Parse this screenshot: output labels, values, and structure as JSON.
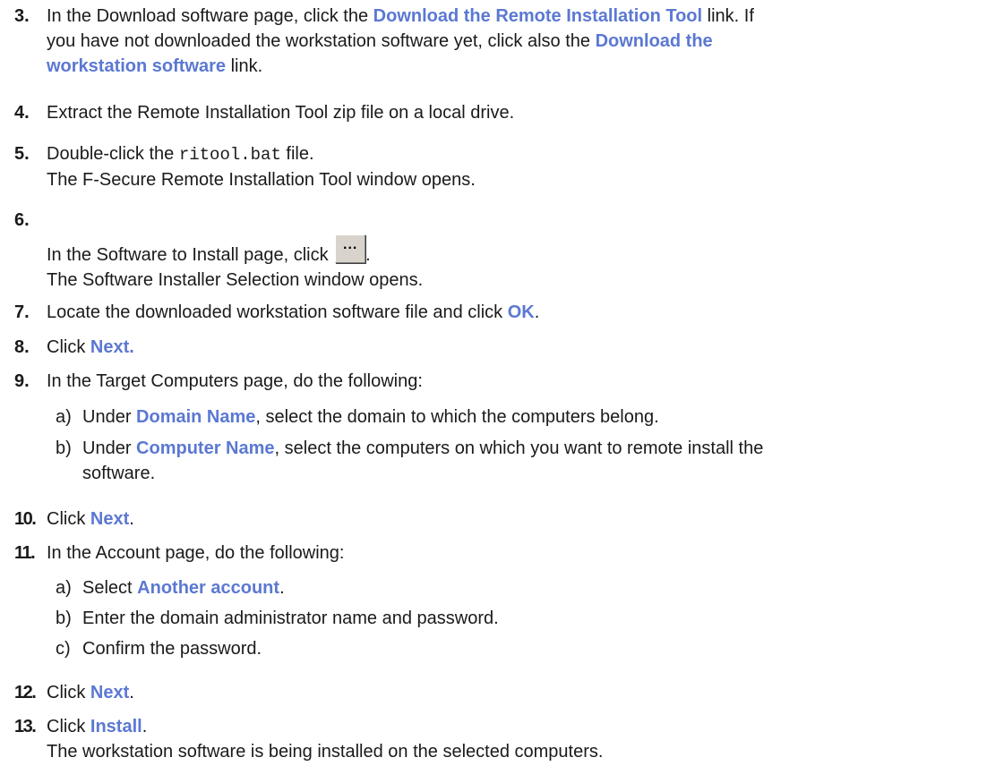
{
  "steps": {
    "s3": {
      "num": "3.",
      "l1a": "In the Download software page, click the ",
      "l1b": "Download the Remote Installation Tool",
      "l1c": " link. If",
      "l2a": "you have not downloaded the workstation software yet, click also the ",
      "l2b": "Download the",
      "l3a": "workstation software",
      "l3b": " link."
    },
    "s4": {
      "num": "4.",
      "text": "Extract the Remote Installation Tool zip file on a local drive."
    },
    "s5": {
      "num": "5.",
      "l1a": "Double-click the ",
      "l1b": "ritool.bat",
      "l1c": " file.",
      "l2": "The F-Secure Remote Installation Tool window opens."
    },
    "s6": {
      "num": "6.",
      "l1": "In the Software to Install page, click ",
      "icon": "ellipsis-button-icon",
      "icon_text": "...",
      "l1end": ".",
      "l2": "The Software Installer Selection window opens."
    },
    "s7": {
      "num": "7.",
      "a": "Locate the downloaded workstation software file and click ",
      "b": "OK",
      "c": "."
    },
    "s8": {
      "num": "8.",
      "a": "Click ",
      "b": "Next."
    },
    "s9": {
      "num": "9.",
      "text": "In the Target Computers page, do the following:",
      "a": {
        "letter": "a)",
        "t1": "Under ",
        "t2": "Domain Name",
        "t3": ", select the domain to which the computers belong."
      },
      "b": {
        "letter": "b)",
        "t1": "Under ",
        "t2": "Computer Name",
        "t3": ", select the computers on which you want to remote install the",
        "t4": "software."
      }
    },
    "s10": {
      "num": "10.",
      "a": "Click ",
      "b": "Next",
      "c": "."
    },
    "s11": {
      "num": "11.",
      "text": "In the Account page, do the following:",
      "a": {
        "letter": "a)",
        "t1": "Select ",
        "t2": "Another account",
        "t3": "."
      },
      "b": {
        "letter": "b)",
        "t1": "Enter the domain administrator name and password."
      },
      "c": {
        "letter": "c)",
        "t1": "Confirm the password."
      }
    },
    "s12": {
      "num": "12.",
      "a": "Click ",
      "b": "Next",
      "c": "."
    },
    "s13": {
      "num": "13.",
      "a": "Click ",
      "b": "Install",
      "c": ".",
      "l2": "The workstation software is being installed on the selected computers."
    }
  },
  "colors": {
    "ui_label": "#5b78d2",
    "text": "#1a1a1a"
  }
}
